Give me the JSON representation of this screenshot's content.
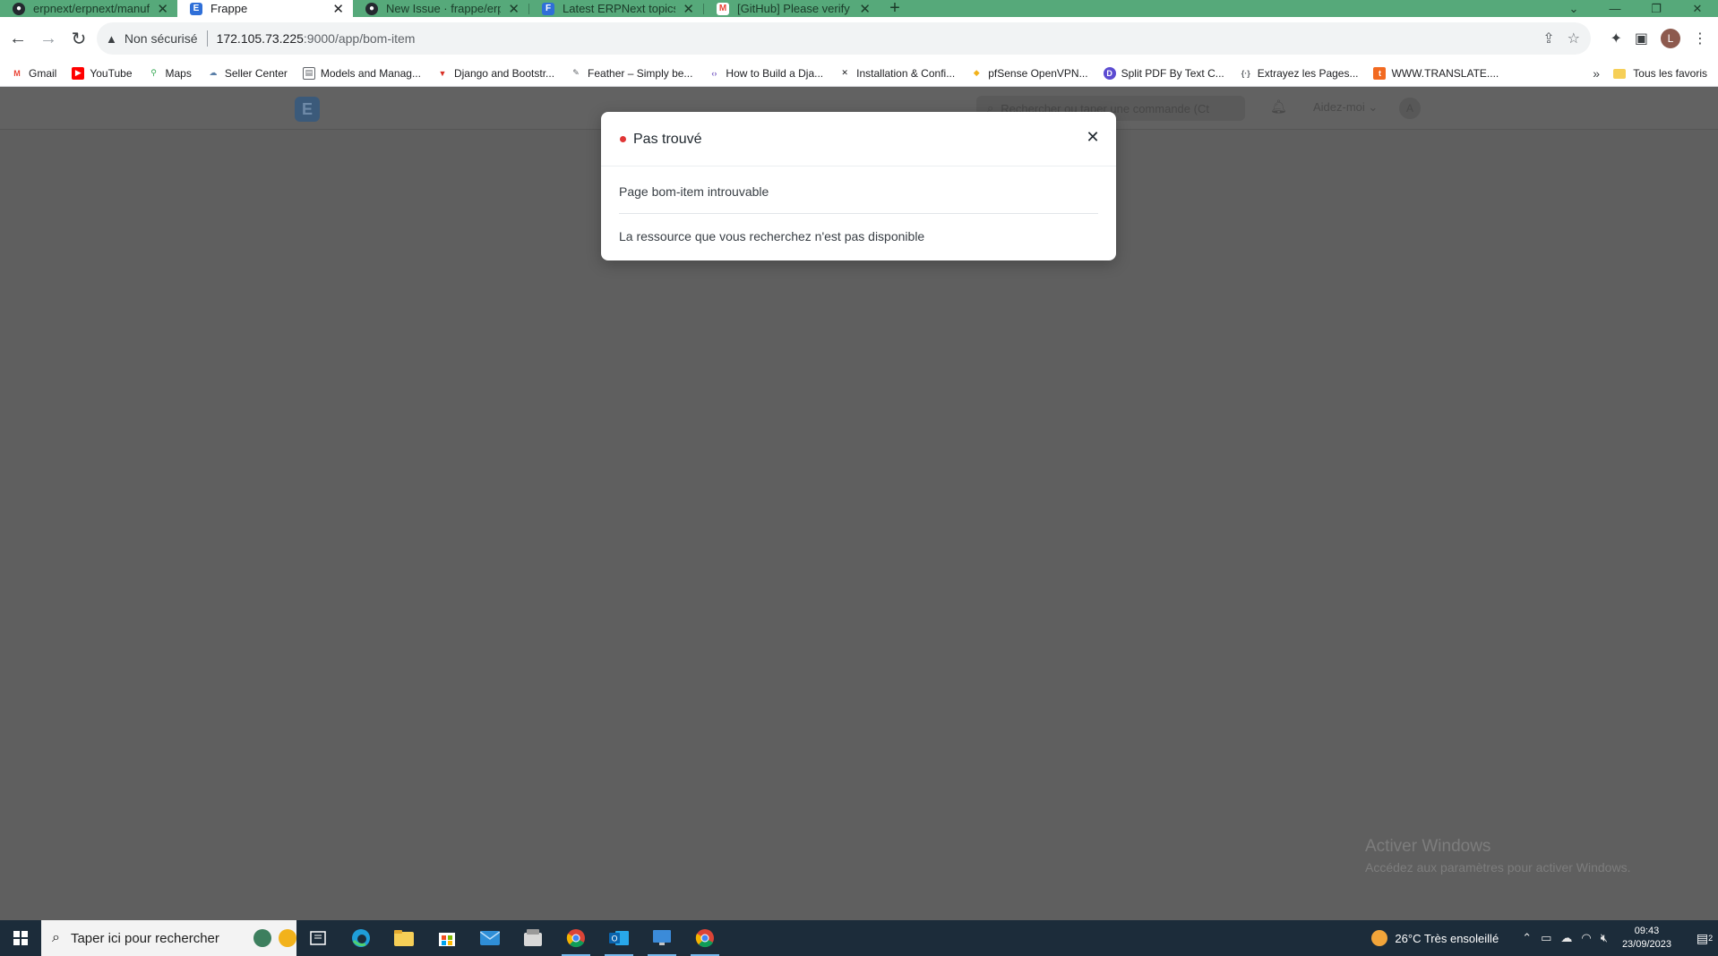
{
  "browser": {
    "tabs": [
      {
        "title": "erpnext/erpnext/manufacturing/...",
        "favicon": "github-icon",
        "active": false
      },
      {
        "title": "Frappe",
        "favicon": "erpnext-icon",
        "active": true
      },
      {
        "title": "New Issue · frappe/erpnext",
        "favicon": "github-icon",
        "active": false
      },
      {
        "title": "Latest ERPNext topics - Frappe F",
        "favicon": "frappe-forum-icon",
        "active": false
      },
      {
        "title": "[GitHub] Please verify your devic",
        "favicon": "gmail-icon",
        "active": false
      }
    ],
    "new_tab_label": "+",
    "security_label": "Non sécurisé",
    "url_host": "172.105.73.225",
    "url_path": ":9000/app/bom-item",
    "profile_initial": "L",
    "bookmarks": [
      {
        "label": "Gmail",
        "icon": "gmail-icon",
        "color": "#ea4335"
      },
      {
        "label": "YouTube",
        "icon": "youtube-icon",
        "color": "#ff0000"
      },
      {
        "label": "Maps",
        "icon": "maps-icon",
        "color": "#34a853"
      },
      {
        "label": "Seller Center",
        "icon": "seller-center-icon",
        "color": "#5b7fa8"
      },
      {
        "label": "Models and Manag...",
        "icon": "document-icon",
        "color": "#5f6368"
      },
      {
        "label": "Django and Bootstr...",
        "icon": "vuetify-icon",
        "color": "#d93025"
      },
      {
        "label": "Feather – Simply be...",
        "icon": "feather-icon",
        "color": "#5f6368"
      },
      {
        "label": "How to Build a Dja...",
        "icon": "code-icon",
        "color": "#7a5fc4"
      },
      {
        "label": "Installation & Confi...",
        "icon": "x-logo-icon",
        "color": "#202124"
      },
      {
        "label": "pfSense OpenVPN...",
        "icon": "pfsense-icon",
        "color": "#f2b21b"
      },
      {
        "label": "Split PDF By Text C...",
        "icon": "d-logo-icon",
        "color": "#5b4bd1"
      },
      {
        "label": "Extrayez les Pages...",
        "icon": "bracket-icon",
        "color": "#5f6368"
      },
      {
        "label": "WWW.TRANSLATE....",
        "icon": "translate-icon",
        "color": "#f26a21"
      }
    ],
    "bookmarks_all_label": "Tous les favoris"
  },
  "app": {
    "logo_letter": "E",
    "search_placeholder": "Rechercher ou taper une commande (Ct",
    "help_label": "Aidez-moi",
    "avatar_initial": "A"
  },
  "modal": {
    "title": "Pas trouvé",
    "message_1": "Page bom-item introuvable",
    "message_2": "La ressource que vous recherchez n'est pas disponible",
    "indicator_color": "#e03636"
  },
  "watermark": {
    "line1": "Activer Windows",
    "line2": "Accédez aux paramètres pour activer Windows."
  },
  "taskbar": {
    "search_placeholder": "Taper ici pour rechercher",
    "weather": "26°C  Très ensoleillé",
    "time": "09:43",
    "date": "23/09/2023",
    "notification_count": "2"
  }
}
